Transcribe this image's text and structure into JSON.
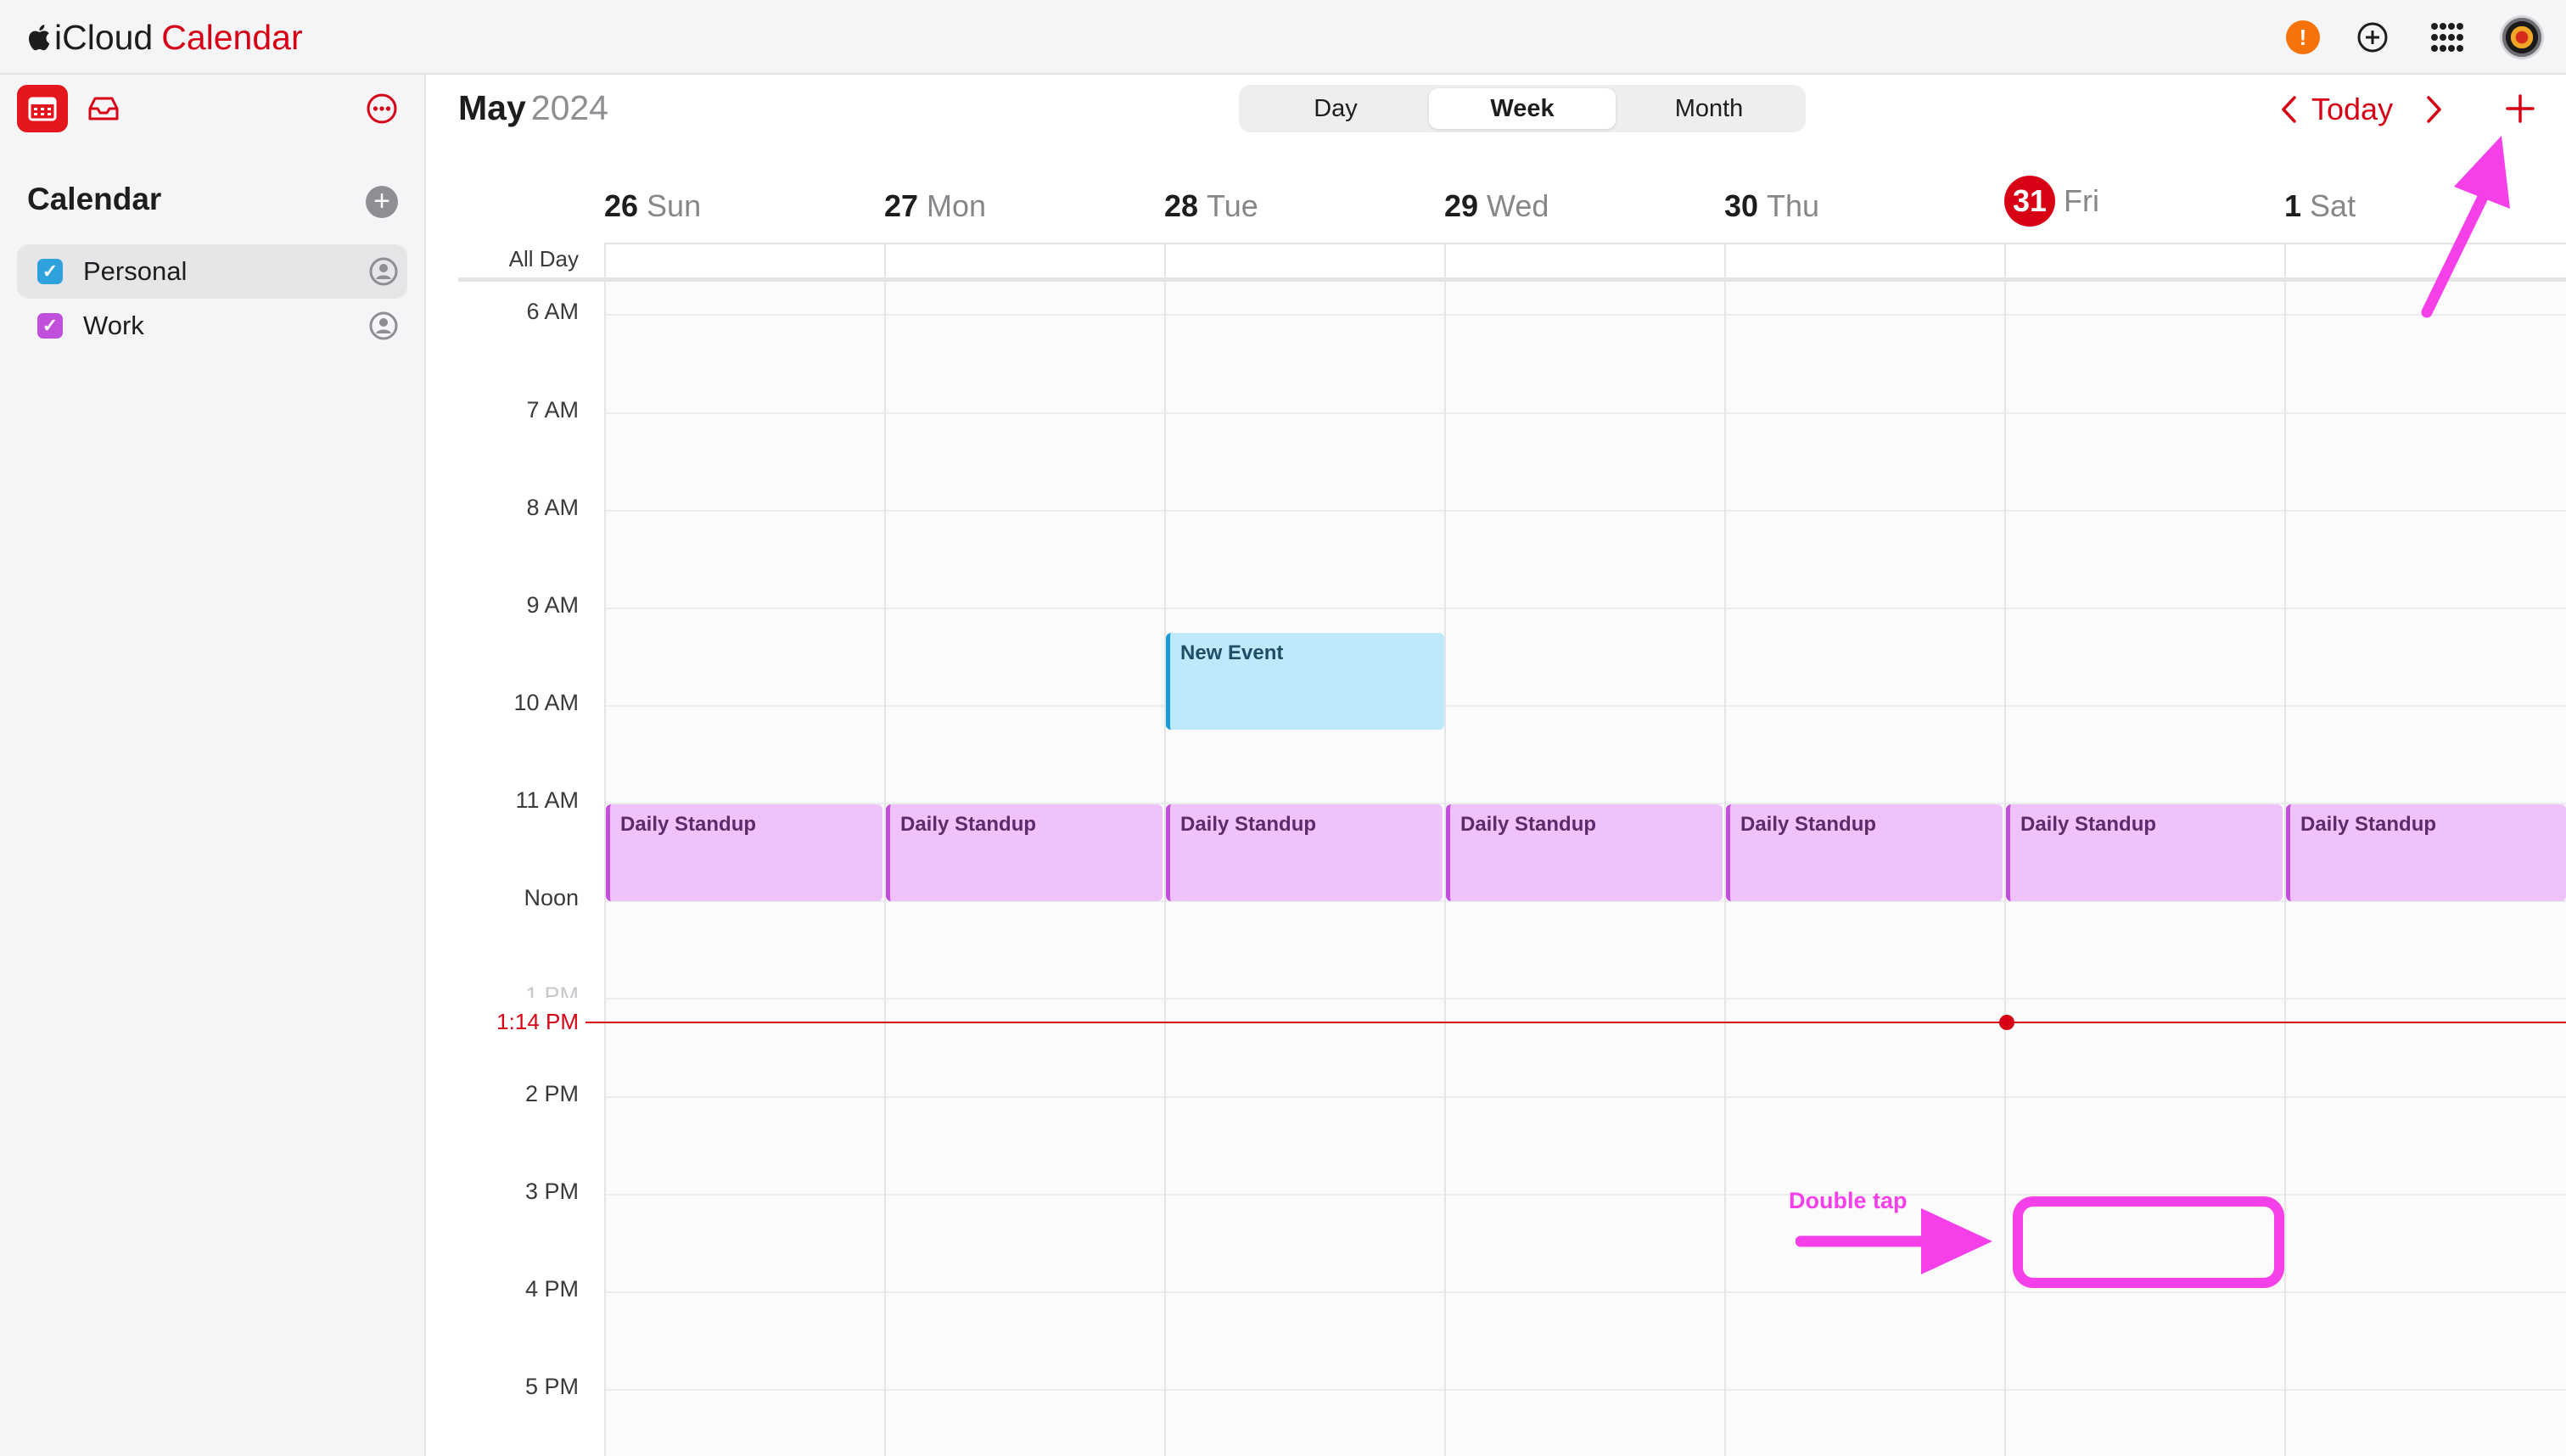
{
  "app": {
    "brand_prefix": "iCloud",
    "brand_name": "Calendar"
  },
  "colors": {
    "accent": "#d70015",
    "personal": "#1c9ad6",
    "work": "#c24fdb",
    "annotation": "#f53fe8"
  },
  "topbar": {
    "alert_glyph": "!",
    "icons": [
      "alert-icon",
      "add-circle-icon",
      "app-grid-icon",
      "avatar"
    ]
  },
  "sidebar": {
    "title": "Calendar",
    "calendars": [
      {
        "label": "Personal",
        "checked": true,
        "color": "#2fa2dd",
        "selected": true
      },
      {
        "label": "Work",
        "checked": true,
        "color": "#c04fdc",
        "selected": false
      }
    ]
  },
  "header": {
    "month": "May",
    "year": "2024",
    "views": [
      "Day",
      "Week",
      "Month"
    ],
    "active_view": "Week",
    "today_label": "Today"
  },
  "days": [
    {
      "num": "26",
      "name": "Sun",
      "today": false
    },
    {
      "num": "27",
      "name": "Mon",
      "today": false
    },
    {
      "num": "28",
      "name": "Tue",
      "today": false
    },
    {
      "num": "29",
      "name": "Wed",
      "today": false
    },
    {
      "num": "30",
      "name": "Thu",
      "today": false
    },
    {
      "num": "31",
      "name": "Fri",
      "today": true
    },
    {
      "num": "1",
      "name": "Sat",
      "today": false
    }
  ],
  "allday_label": "All Day",
  "hours": [
    "6 AM",
    "7 AM",
    "8 AM",
    "9 AM",
    "10 AM",
    "11 AM",
    "Noon",
    "1 PM",
    "2 PM",
    "3 PM",
    "4 PM",
    "5 PM"
  ],
  "now_label": "1:14 PM",
  "events": [
    {
      "title": "New Event",
      "calendar": "personal",
      "day": 2,
      "start": "9:15 AM",
      "end": "10:15 AM"
    },
    {
      "title": "Daily Standup",
      "calendar": "work",
      "day": 0,
      "start": "11:00 AM",
      "end": "12:00 PM"
    },
    {
      "title": "Daily Standup",
      "calendar": "work",
      "day": 1,
      "start": "11:00 AM",
      "end": "12:00 PM"
    },
    {
      "title": "Daily Standup",
      "calendar": "work",
      "day": 2,
      "start": "11:00 AM",
      "end": "12:00 PM"
    },
    {
      "title": "Daily Standup",
      "calendar": "work",
      "day": 3,
      "start": "11:00 AM",
      "end": "12:00 PM"
    },
    {
      "title": "Daily Standup",
      "calendar": "work",
      "day": 4,
      "start": "11:00 AM",
      "end": "12:00 PM"
    },
    {
      "title": "Daily Standup",
      "calendar": "work",
      "day": 5,
      "start": "11:00 AM",
      "end": "12:00 PM"
    },
    {
      "title": "Daily Standup",
      "calendar": "work",
      "day": 6,
      "start": "11:00 AM",
      "end": "12:00 PM"
    }
  ],
  "annotation": {
    "text": "Double tap"
  }
}
